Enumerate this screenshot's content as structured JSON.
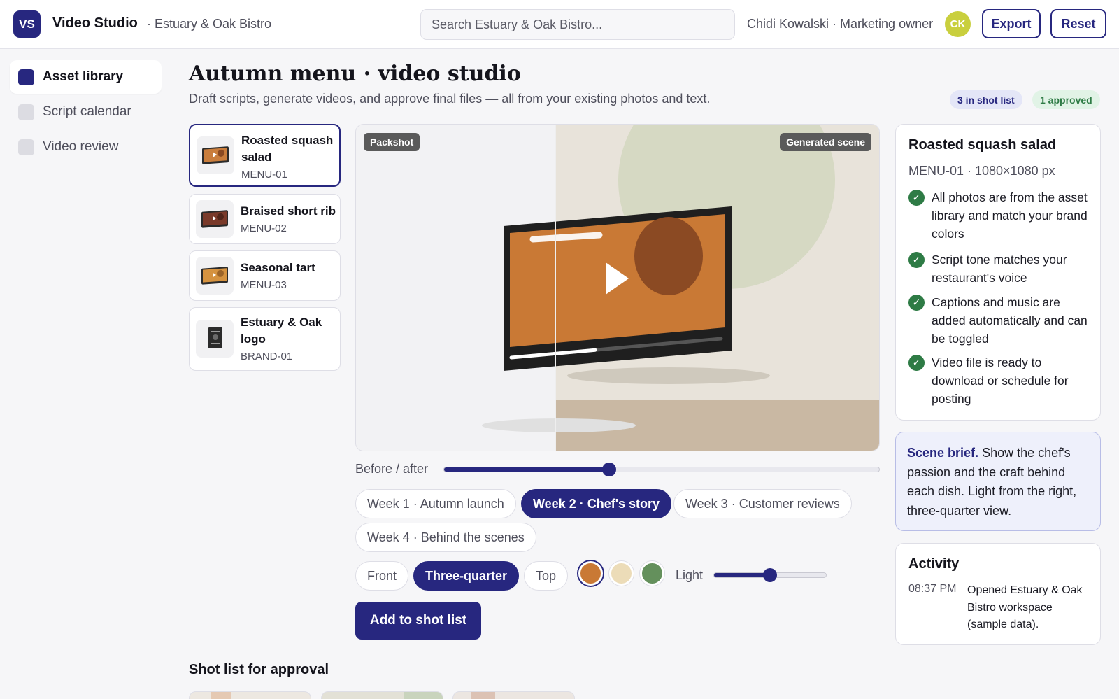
{
  "app": {
    "logo_text": "VS",
    "title": "Video Studio",
    "workspace": "· Estuary & Oak Bistro"
  },
  "search": {
    "placeholder": "Search Estuary & Oak Bistro..."
  },
  "user": {
    "label": "Chidi Kowalski · Marketing owner",
    "initials": "CK",
    "avatar_color": "#c9cf3e"
  },
  "header_buttons": {
    "export": "Export",
    "reset": "Reset"
  },
  "sidebar": {
    "items": [
      {
        "label": "Asset library",
        "active": true
      },
      {
        "label": "Script calendar",
        "active": false
      },
      {
        "label": "Video review",
        "active": false
      }
    ]
  },
  "page": {
    "title": "Autumn menu · video studio",
    "subtitle": "Draft scripts, generate videos, and approve final files — all from your existing photos and text.",
    "badges": {
      "shot_list": "3 in shot list",
      "approved": "1 approved"
    }
  },
  "assets": [
    {
      "name": "Roasted squash salad",
      "code": "MENU-01",
      "selected": true,
      "thumb_color": "#c97d3c"
    },
    {
      "name": "Braised short rib",
      "code": "MENU-02",
      "selected": false,
      "thumb_color": "#7a3a2a"
    },
    {
      "name": "Seasonal tart",
      "code": "MENU-03",
      "selected": false,
      "thumb_color": "#d5923f"
    },
    {
      "name": "Estuary & Oak logo",
      "code": "BRAND-01",
      "selected": false,
      "thumb_color": "#2b2b2b"
    }
  ],
  "stage": {
    "left_label": "Packshot",
    "right_label": "Generated scene",
    "before_after_label": "Before / after",
    "before_after_value": 0.38,
    "video_progress": 0.4
  },
  "weeks": [
    {
      "label": "Week 1 · Autumn launch",
      "active": false
    },
    {
      "label": "Week 2 · Chef's story",
      "active": true
    },
    {
      "label": "Week 3 · Customer reviews",
      "active": false
    },
    {
      "label": "Week 4 · Behind the scenes",
      "active": false
    }
  ],
  "angles": [
    {
      "label": "Front",
      "active": false
    },
    {
      "label": "Three-quarter",
      "active": true
    },
    {
      "label": "Top",
      "active": false
    }
  ],
  "swatches": [
    {
      "name": "orange-swatch",
      "color": "#c97935",
      "selected": true
    },
    {
      "name": "cream-swatch",
      "color": "#ecdcb8",
      "selected": false
    },
    {
      "name": "green-swatch",
      "color": "#64905c",
      "selected": false
    }
  ],
  "light": {
    "label": "Light",
    "value": 0.5
  },
  "add_button": "Add to shot list",
  "shot_list_title": "Shot list for approval",
  "detail": {
    "name": "Roasted squash salad",
    "meta": "MENU-01 · 1080×1080 px",
    "checks": [
      "All photos are from the asset library and match your brand colors",
      "Script tone matches your restaurant's voice",
      "Captions and music are added automatically and can be toggled",
      "Video file is ready to download or schedule for posting"
    ]
  },
  "brief": {
    "label": "Scene brief.",
    "text": "Show the chef's passion and the craft behind each dish. Light from the right, three-quarter view."
  },
  "activity": {
    "title": "Activity",
    "time": "08:37 PM",
    "text": "Opened Estuary & Oak Bistro workspace (sample data)."
  },
  "colors": {
    "accent": "#27277f",
    "success": "#2e7b45",
    "video_orange": "#c97935"
  }
}
